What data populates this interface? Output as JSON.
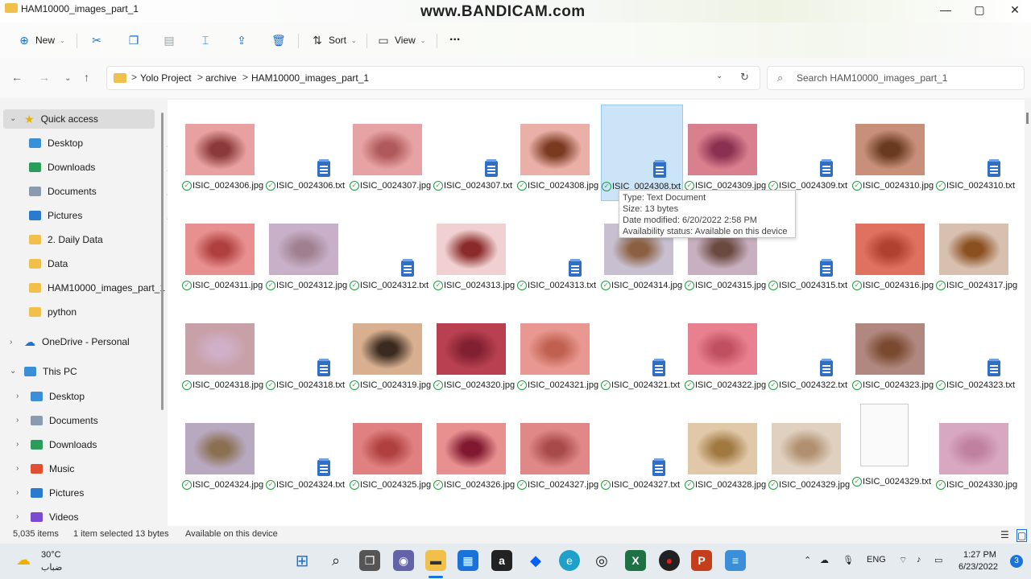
{
  "window": {
    "title": "HAM10000_images_part_1",
    "watermark": "www.BANDICAM.com",
    "controls": {
      "minimize": "—",
      "maximize": "▢",
      "close": "✕"
    }
  },
  "toolbar": {
    "new_label": "New",
    "sort_label": "Sort",
    "view_label": "View",
    "more_label": "..."
  },
  "address": {
    "crumbs": [
      "Yolo Project",
      "archive",
      "HAM10000_images_part_1"
    ],
    "separator": ">",
    "search_placeholder": "Search HAM10000_images_part_1"
  },
  "sidebar": {
    "quick_access": "Quick access",
    "quick_items": [
      {
        "label": "Desktop",
        "icon": "desktop-icon",
        "pinned": true
      },
      {
        "label": "Downloads",
        "icon": "download-icon",
        "pinned": true
      },
      {
        "label": "Documents",
        "icon": "documents-icon",
        "pinned": true
      },
      {
        "label": "Pictures",
        "icon": "pictures-icon",
        "pinned": true
      },
      {
        "label": "2. Daily Data",
        "icon": "folder-icon",
        "pinned": false
      },
      {
        "label": "Data",
        "icon": "folder-icon",
        "pinned": false
      },
      {
        "label": "HAM10000_images_part_1",
        "icon": "folder-icon",
        "pinned": false
      },
      {
        "label": "python",
        "icon": "folder-icon",
        "pinned": false
      }
    ],
    "onedrive": "OneDrive - Personal",
    "this_pc": "This PC",
    "pc_items": [
      {
        "label": "Desktop",
        "icon": "desktop-icon"
      },
      {
        "label": "Documents",
        "icon": "documents-icon"
      },
      {
        "label": "Downloads",
        "icon": "download-icon"
      },
      {
        "label": "Music",
        "icon": "music-icon"
      },
      {
        "label": "Pictures",
        "icon": "pictures-icon"
      },
      {
        "label": "Videos",
        "icon": "videos-icon"
      }
    ]
  },
  "files": [
    [
      {
        "name": "ISIC_0024306.jpg",
        "kind": "jpg",
        "bg": "#e8a0a0",
        "spot": "#8a3a3a"
      },
      {
        "name": "ISIC_0024306.txt",
        "kind": "txt"
      },
      {
        "name": "ISIC_0024307.jpg",
        "kind": "jpg",
        "bg": "#e7a3a3",
        "spot": "#b0595a"
      },
      {
        "name": "ISIC_0024307.txt",
        "kind": "txt"
      },
      {
        "name": "ISIC_0024308.jpg",
        "kind": "jpg",
        "bg": "#eab0a8",
        "spot": "#7a3a20"
      },
      {
        "name": "ISIC_0024308.txt",
        "kind": "txt",
        "selected": true
      },
      {
        "name": "ISIC_0024309.jpg",
        "kind": "jpg",
        "bg": "#d9808f",
        "spot": "#8a3050"
      },
      {
        "name": "ISIC_0024309.txt",
        "kind": "txt"
      },
      {
        "name": "ISIC_0024310.jpg",
        "kind": "jpg",
        "bg": "#c8907a",
        "spot": "#6a3a20"
      },
      {
        "name": "ISIC_0024310.txt",
        "kind": "txt"
      }
    ],
    [
      {
        "name": "ISIC_0024311.jpg",
        "kind": "jpg",
        "bg": "#e89090",
        "spot": "#b04040"
      },
      {
        "name": "ISIC_0024312.jpg",
        "kind": "jpg",
        "bg": "#c8b0c8",
        "spot": "#a08090"
      },
      {
        "name": "ISIC_0024312.txt",
        "kind": "txt"
      },
      {
        "name": "ISIC_0024313.jpg",
        "kind": "jpg",
        "bg": "#f0d0d0",
        "spot": "#8a2a2a"
      },
      {
        "name": "ISIC_0024313.txt",
        "kind": "txt"
      },
      {
        "name": "ISIC_0024314.jpg",
        "kind": "jpg",
        "bg": "#c8c0d0",
        "spot": "#8a6040"
      },
      {
        "name": "ISIC_0024315.jpg",
        "kind": "jpg",
        "bg": "#c8b0c0",
        "spot": "#6a4a40"
      },
      {
        "name": "ISIC_0024315.txt",
        "kind": "txt"
      },
      {
        "name": "ISIC_0024316.jpg",
        "kind": "jpg",
        "bg": "#e07060",
        "spot": "#b04030"
      },
      {
        "name": "ISIC_0024317.jpg",
        "kind": "jpg",
        "bg": "#d8c0b0",
        "spot": "#8a5020"
      }
    ],
    [
      {
        "name": "ISIC_0024318.jpg",
        "kind": "jpg",
        "bg": "#c8a0a8",
        "spot": "#d0b0c8"
      },
      {
        "name": "ISIC_0024318.txt",
        "kind": "txt"
      },
      {
        "name": "ISIC_0024319.jpg",
        "kind": "jpg",
        "bg": "#d8b090",
        "spot": "#3a2a20"
      },
      {
        "name": "ISIC_0024320.jpg",
        "kind": "jpg",
        "bg": "#b84050",
        "spot": "#802030"
      },
      {
        "name": "ISIC_0024321.jpg",
        "kind": "jpg",
        "bg": "#e89890",
        "spot": "#c06050"
      },
      {
        "name": "ISIC_0024321.txt",
        "kind": "txt"
      },
      {
        "name": "ISIC_0024322.jpg",
        "kind": "jpg",
        "bg": "#e88090",
        "spot": "#c05060"
      },
      {
        "name": "ISIC_0024322.txt",
        "kind": "txt"
      },
      {
        "name": "ISIC_0024323.jpg",
        "kind": "jpg",
        "bg": "#b08880",
        "spot": "#7a4a30"
      },
      {
        "name": "ISIC_0024323.txt",
        "kind": "txt"
      }
    ],
    [
      {
        "name": "ISIC_0024324.jpg",
        "kind": "jpg",
        "bg": "#b8a8c0",
        "spot": "#8a7050"
      },
      {
        "name": "ISIC_0024324.txt",
        "kind": "txt"
      },
      {
        "name": "ISIC_0024325.jpg",
        "kind": "jpg",
        "bg": "#e08080",
        "spot": "#b04040"
      },
      {
        "name": "ISIC_0024326.jpg",
        "kind": "jpg",
        "bg": "#e89090",
        "spot": "#801830"
      },
      {
        "name": "ISIC_0024327.jpg",
        "kind": "jpg",
        "bg": "#e08888",
        "spot": "#a84a4a"
      },
      {
        "name": "ISIC_0024327.txt",
        "kind": "txt"
      },
      {
        "name": "ISIC_0024328.jpg",
        "kind": "jpg",
        "bg": "#e0c8a8",
        "spot": "#a07840"
      },
      {
        "name": "ISIC_0024329.jpg",
        "kind": "jpg",
        "bg": "#e0d0c0",
        "spot": "#b09070"
      },
      {
        "name": "ISIC_0024329.txt",
        "kind": "doc"
      },
      {
        "name": "ISIC_0024330.jpg",
        "kind": "jpg",
        "bg": "#d8a8c0",
        "spot": "#c080a0"
      }
    ]
  ],
  "tooltip": {
    "type": "Type: Text Document",
    "size": "Size: 13 bytes",
    "modified": "Date modified: 6/20/2022 2:58 PM",
    "availability": "Availability status: Available on this device"
  },
  "status": {
    "items": "5,035 items",
    "selected": "1 item selected  13 bytes",
    "availability": "Available on this device"
  },
  "taskbar": {
    "weather_temp": "30°C",
    "weather_desc": "ضباب",
    "lang": "ENG",
    "time": "1:27 PM",
    "date": "6/23/2022",
    "notif_count": "3"
  }
}
